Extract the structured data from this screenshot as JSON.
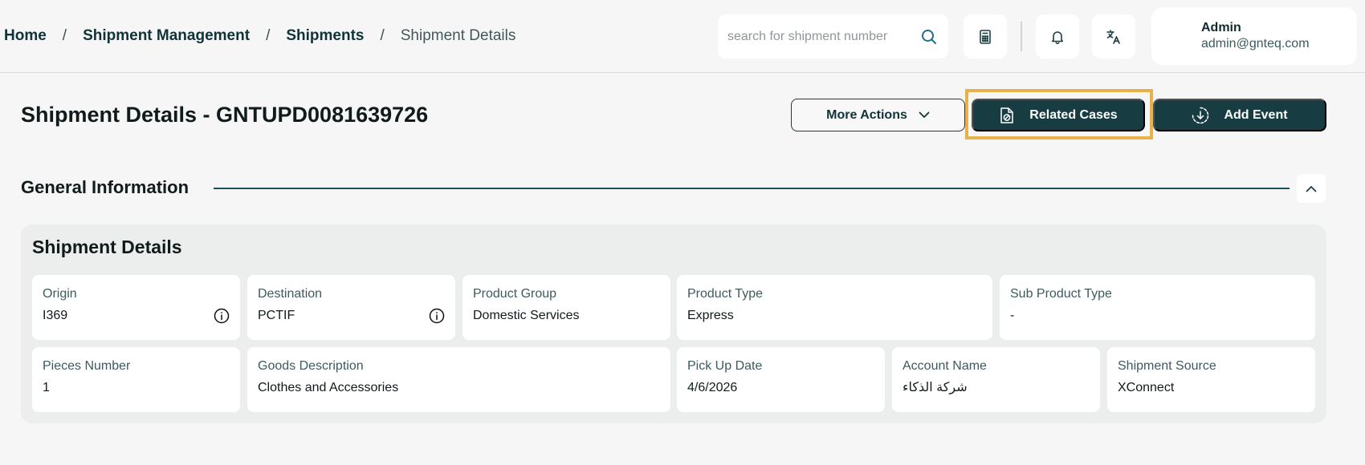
{
  "breadcrumb": {
    "home": "Home",
    "shipment_management": "Shipment Management",
    "shipments": "Shipments",
    "current": "Shipment Details",
    "separator": "/"
  },
  "search": {
    "placeholder": "search for shipment number",
    "value": ""
  },
  "user": {
    "name": "Admin",
    "email": "admin@gnteq.com"
  },
  "page": {
    "title": "Shipment Details - GNTUPD0081639726"
  },
  "actions": {
    "more_actions": "More Actions",
    "related_cases": "Related Cases",
    "add_event": "Add Event"
  },
  "section": {
    "title": "General Information"
  },
  "shipment_details": {
    "title": "Shipment Details",
    "fields": [
      {
        "label": "Origin",
        "value": "I369",
        "info": true
      },
      {
        "label": "Destination",
        "value": "PCTIF",
        "info": true
      },
      {
        "label": "Product Group",
        "value": "Domestic Services"
      },
      {
        "label": "Product Type",
        "value": "Express"
      },
      {
        "label": "Sub Product Type",
        "value": "-"
      },
      {
        "label": "Pieces Number",
        "value": "1"
      },
      {
        "label": "Goods Description",
        "value": "Clothes and Accessories"
      },
      {
        "label": "Pick Up Date",
        "value": "4/6/2026"
      },
      {
        "label": "Account Name",
        "value": "شركة الذكاء"
      },
      {
        "label": "Shipment Source",
        "value": "XConnect"
      }
    ]
  },
  "icons": {
    "search": "search-icon",
    "calculator": "calculator-icon",
    "bell": "bell-icon",
    "translate": "translate-icon",
    "chevron_down": "chevron-down-icon",
    "related_cases": "related-cases-icon",
    "add_event": "add-event-icon",
    "collapse": "chevron-up-icon",
    "info": "info-icon"
  },
  "colors": {
    "primary_dark": "#173d42",
    "highlight": "#e8b24a",
    "background": "#f5f6f5",
    "panel": "#ebeeed"
  }
}
